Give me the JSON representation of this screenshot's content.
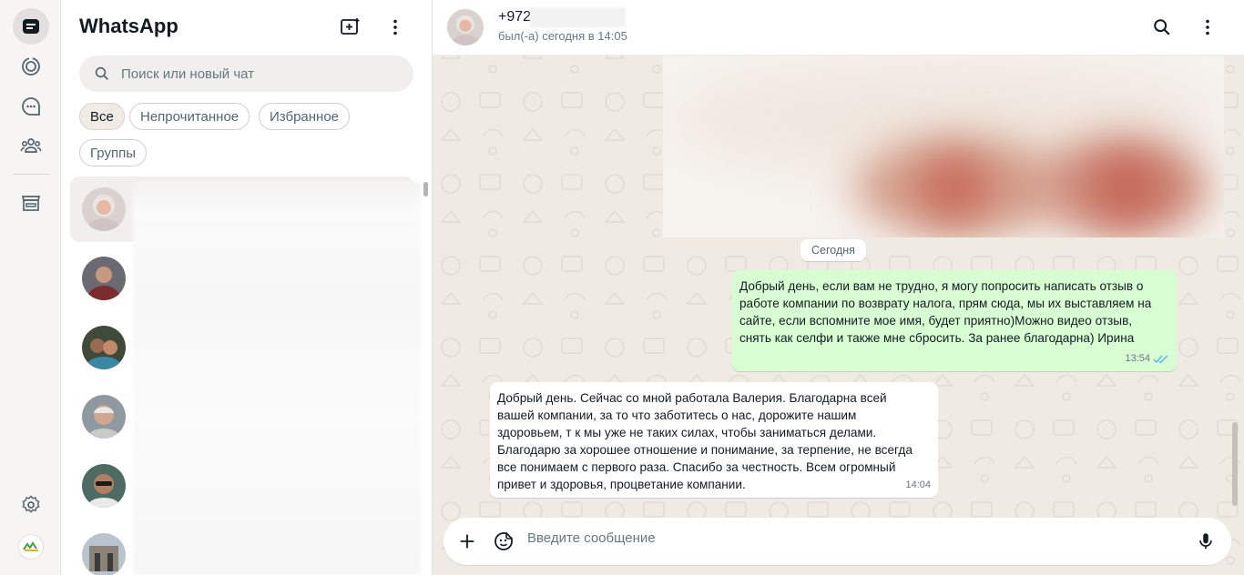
{
  "app": {
    "title": "WhatsApp"
  },
  "rail": {
    "items": [
      {
        "icon": "chats-icon",
        "active": true
      },
      {
        "icon": "status-icon"
      },
      {
        "icon": "channels-icon"
      },
      {
        "icon": "communities-icon"
      },
      {
        "icon": "store-icon"
      },
      {
        "icon": "settings-icon"
      },
      {
        "icon": "profile-avatar"
      }
    ]
  },
  "list": {
    "search_placeholder": "Поиск или новый чат",
    "filters": [
      "Все",
      "Непрочитанное",
      "Избранное",
      "Группы"
    ],
    "active_filter": "Все"
  },
  "conversation": {
    "contact_name": "+972",
    "contact_status": "был(-а) сегодня в 14:05",
    "day_divider": "Сегодня",
    "messages": [
      {
        "direction": "out",
        "lines": [
          "Добрый день, если вам не трудно, я  могу попросить написать отзыв о",
          "работе компании по возврату налога, прям сюда, мы их выставляем на",
          "сайте, если вспомните мое имя, будет приятно)Можно видео отзыв,",
          "снять как селфи и также мне сбросить.  За ранее благодарна) Ирина"
        ],
        "time": "13:54",
        "status": "read"
      },
      {
        "direction": "in",
        "lines": [
          "Добрый день. Сейчас со мной работала Валерия. Благодарна всей",
          "вашей компании, за то что заботитесь о нас, дорожите нашим",
          "здоровьем, т к мы уже не таких силах, чтобы заниматься делами.",
          "Благодарю за хорошее отношение и понимание, за терпение, не всегда",
          "все понимаем с первого раза. Спасибо за честность. Всем огромный",
          "привет и здоровья, процветание компании."
        ],
        "time": "14:04"
      }
    ],
    "composer_placeholder": "Введите сообщение"
  },
  "colors": {
    "accent": "#00a884",
    "outgoing_bubble": "#d9fdd3",
    "chat_bg": "#efeae2",
    "read_ticks": "#53bdeb"
  }
}
